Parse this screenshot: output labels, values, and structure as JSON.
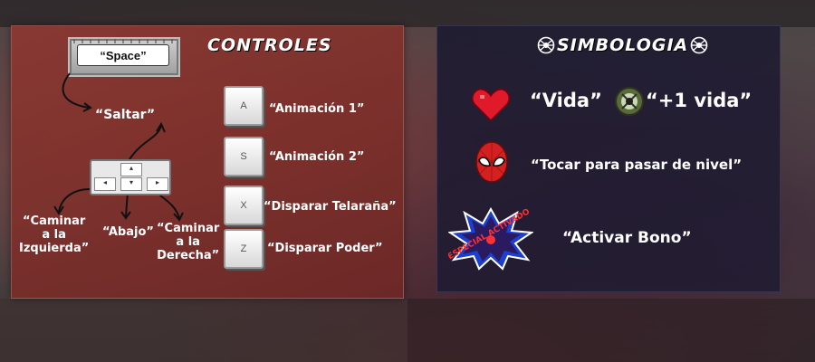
{
  "controls": {
    "title": "CONTROLES",
    "space_key": "“Space”",
    "jump_label": "“Saltar”",
    "walk_left_label": "“Caminar\na la\nIzquierda”",
    "down_label": "“Abajo”",
    "walk_right_label": "“Caminar\na la\nDerecha”",
    "keys": [
      {
        "key": "A",
        "action": "“Animación 1”"
      },
      {
        "key": "S",
        "action": "“Animación 2”"
      },
      {
        "key": "X",
        "action": "“Disparar Telaraña”"
      },
      {
        "key": "Z",
        "action": "“Disparar Poder”"
      }
    ]
  },
  "legend": {
    "title": "SIMBOLOGIA",
    "life_label": "“Vida”",
    "extra_life_label": "“+1 vida”",
    "next_level_label": "“Tocar para pasar de nivel”",
    "bonus_label": "“Activar Bono”",
    "bonus_badge_text": "ESPECIAL ACTIVADO"
  },
  "colors": {
    "controls_panel": "#8c3730",
    "legend_panel": "#1c1a30",
    "heart": "#e01a2a"
  }
}
